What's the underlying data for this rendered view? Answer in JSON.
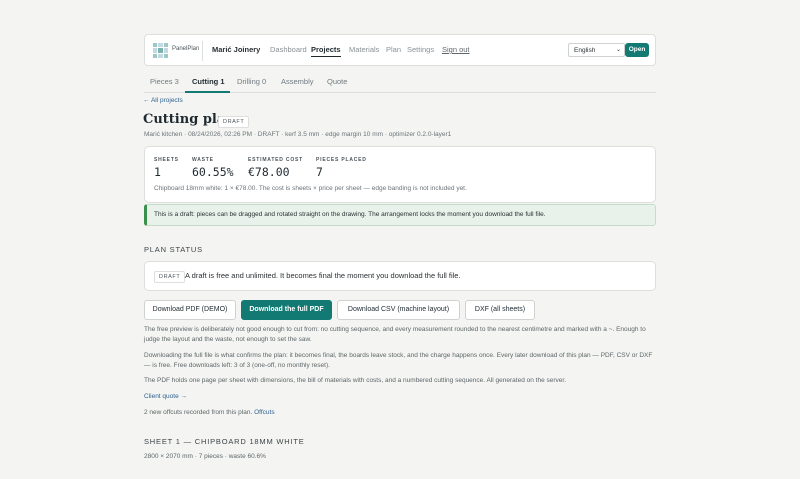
{
  "header": {
    "brand": "PanelPlan",
    "company": "Marić Joinery",
    "nav": [
      "Dashboard",
      "Projects",
      "Materials",
      "Plan",
      "Settings"
    ],
    "active_nav": "Projects",
    "signout": "Sign out",
    "language": "English",
    "open_label": "Open"
  },
  "tabs": [
    {
      "label": "Pieces 3"
    },
    {
      "label": "Cutting 1"
    },
    {
      "label": "Drilling 0"
    },
    {
      "label": "Assembly"
    },
    {
      "label": "Quote"
    }
  ],
  "active_tab": "Cutting 1",
  "back_link": "← All projects",
  "title": "Cutting plan",
  "title_badge": "DRAFT",
  "meta": "Marić kitchen · 08/24/2026, 02:26 PM · DRAFT · kerf 3.5 mm · edge margin 10 mm · optimizer 0.2.0-layer1",
  "stats": {
    "sheets_label": "SHEETS",
    "sheets": "1",
    "waste_label": "WASTE",
    "waste": "60.55%",
    "cost_label": "ESTIMATED COST",
    "cost": "€78.00",
    "pieces_label": "PIECES PLACED",
    "pieces": "7",
    "note": "Chipboard 18mm white: 1 × €78.00. The cost is sheets × price per sheet — edge banding is not included yet."
  },
  "draft_notice": "This is a draft: pieces can be dragged and rotated straight on the drawing. The arrangement locks the moment you download the full file.",
  "plan_status": {
    "heading": "PLAN STATUS",
    "badge": "DRAFT",
    "text": "A draft is free and unlimited. It becomes final the moment you download the full file."
  },
  "buttons": {
    "demo_pdf": "Download PDF (DEMO)",
    "full_pdf": "Download the full PDF",
    "csv": "Download CSV (machine layout)",
    "dxf": "DXF (all sheets)"
  },
  "paragraphs": {
    "p1": "The free preview is deliberately not good enough to cut from: no cutting sequence, and every measurement rounded to the nearest centimetre and marked with a ~. Enough to judge the layout and the waste, not enough to set the saw.",
    "p2": "Downloading the full file is what confirms the plan: it becomes final, the boards leave stock, and the charge happens once. Every later download of this plan — PDF, CSV or DXF — is free. Free downloads left: 3 of 3 (one-off, no monthly reset).",
    "p3": "The PDF holds one page per sheet with dimensions, the bill of materials with costs, and a numbered cutting sequence. All generated on the server."
  },
  "client_quote": "Client quote →",
  "offcuts_text": "2 new offcuts recorded from this plan.",
  "offcuts_link": "Offcuts",
  "sheet": {
    "heading": "SHEET 1 — CHIPBOARD 18MM WHITE",
    "meta": "2800 × 2070 mm · 7 pieces · waste 60.6%"
  }
}
